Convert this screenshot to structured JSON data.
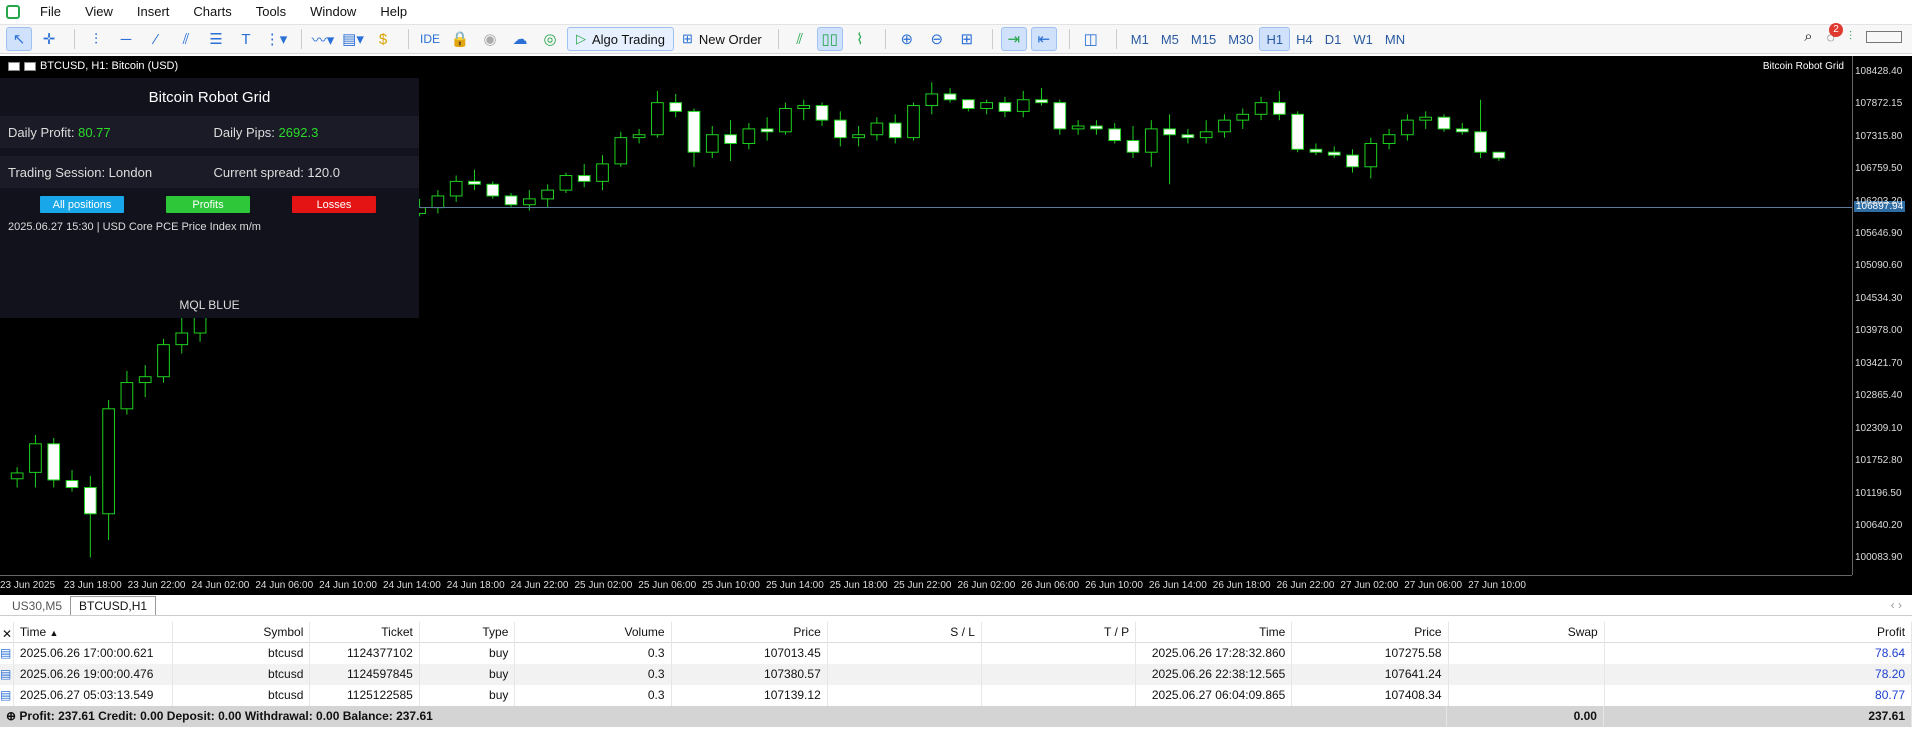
{
  "menu": {
    "items": [
      "File",
      "View",
      "Insert",
      "Charts",
      "Tools",
      "Window",
      "Help"
    ]
  },
  "toolbar": {
    "ide": "IDE",
    "algo": "Algo Trading",
    "new_order": "New Order",
    "timeframes": [
      "M1",
      "M5",
      "M15",
      "M30",
      "H1",
      "H4",
      "D1",
      "W1",
      "MN"
    ],
    "active_tf": "H1",
    "badge": "2"
  },
  "chart": {
    "title": "BTCUSD, H1:  Bitcoin (USD)",
    "indicator_name": "Bitcoin Robot Grid",
    "current_price": "106897.94",
    "yticks": [
      "108428.40",
      "107872.15",
      "107315.80",
      "106759.50",
      "106203.20",
      "105646.90",
      "105090.60",
      "104534.30",
      "103978.00",
      "103421.70",
      "102865.40",
      "102309.10",
      "101752.80",
      "101196.50",
      "100640.20",
      "100083.90"
    ],
    "xticks": [
      "23 Jun 2025",
      "23 Jun 18:00",
      "23 Jun 22:00",
      "24 Jun 02:00",
      "24 Jun 06:00",
      "24 Jun 10:00",
      "24 Jun 14:00",
      "24 Jun 18:00",
      "24 Jun 22:00",
      "25 Jun 02:00",
      "25 Jun 06:00",
      "25 Jun 10:00",
      "25 Jun 14:00",
      "25 Jun 18:00",
      "25 Jun 22:00",
      "26 Jun 02:00",
      "26 Jun 06:00",
      "26 Jun 10:00",
      "26 Jun 14:00",
      "26 Jun 18:00",
      "26 Jun 22:00",
      "27 Jun 02:00",
      "27 Jun 06:00",
      "27 Jun 10:00"
    ]
  },
  "panel": {
    "title": "Bitcoin Robot Grid",
    "daily_profit_label": "Daily Profit:",
    "daily_profit": "80.77",
    "daily_pips_label": "Daily Pips:",
    "daily_pips": "2692.3",
    "session": "Trading Session: London",
    "spread": "Current spread: 120.0",
    "btn_all": "All positions",
    "btn_profits": "Profits",
    "btn_losses": "Losses",
    "news": "2025.06.27 15:30  |  USD    Core PCE Price Index m/m",
    "footer": "MQL BLUE",
    "colors": {
      "all": "#18a7e8",
      "profits": "#2fc73a",
      "losses": "#e41414"
    }
  },
  "tabs": [
    "US30,M5",
    "BTCUSD,H1"
  ],
  "active_tab": "BTCUSD,H1",
  "table": {
    "headers": [
      "Time",
      "Symbol",
      "Ticket",
      "Type",
      "Volume",
      "Price",
      "S / L",
      "T / P",
      "Time",
      "Price",
      "Swap",
      "Profit"
    ],
    "rows": [
      [
        "2025.06.26 17:00:00.621",
        "btcusd",
        "1124377102",
        "buy",
        "0.3",
        "107013.45",
        "",
        "",
        "2025.06.26 17:28:32.860",
        "107275.58",
        "",
        "78.64"
      ],
      [
        "2025.06.26 19:00:00.476",
        "btcusd",
        "1124597845",
        "buy",
        "0.3",
        "107380.57",
        "",
        "",
        "2025.06.26 22:38:12.565",
        "107641.24",
        "",
        "78.20"
      ],
      [
        "2025.06.27 05:03:13.549",
        "btcusd",
        "1125122585",
        "buy",
        "0.3",
        "107139.12",
        "",
        "",
        "2025.06.27 06:04:09.865",
        "107408.34",
        "",
        "80.77"
      ]
    ],
    "summary": "Profit: 237.61  Credit: 0.00  Deposit: 0.00  Withdrawal: 0.00  Balance: 237.61",
    "swap_total": "0.00",
    "profit_total": "237.61"
  },
  "chart_data": {
    "type": "candlestick",
    "symbol": "BTCUSD",
    "timeframe": "H1",
    "ylim": [
      99800,
      108700
    ],
    "candles": [
      [
        101450,
        101650,
        101300,
        101550
      ],
      [
        101560,
        102200,
        101300,
        102050
      ],
      [
        102050,
        102150,
        101300,
        101430
      ],
      [
        101420,
        101600,
        101230,
        101300
      ],
      [
        101300,
        101500,
        100100,
        100850
      ],
      [
        100850,
        102800,
        100400,
        102650
      ],
      [
        102650,
        103300,
        102550,
        103100
      ],
      [
        103100,
        103400,
        102850,
        103200
      ],
      [
        103200,
        103850,
        103100,
        103750
      ],
      [
        103750,
        104250,
        103600,
        103950
      ],
      [
        103950,
        104600,
        103800,
        104450
      ],
      [
        104450,
        104900,
        104300,
        104750
      ],
      [
        104750,
        105300,
        104600,
        105100
      ],
      [
        105100,
        105700,
        104950,
        105550
      ],
      [
        105500,
        105550,
        105050,
        105150
      ],
      [
        105150,
        106350,
        105050,
        106200
      ],
      [
        106200,
        106350,
        106000,
        106100
      ],
      [
        106100,
        106100,
        105450,
        105550
      ],
      [
        105550,
        106100,
        105450,
        105850
      ],
      [
        105850,
        106250,
        105700,
        106100
      ],
      [
        106100,
        106200,
        105900,
        106050
      ],
      [
        106050,
        106150,
        105950,
        106000
      ],
      [
        106000,
        106250,
        105950,
        106100
      ],
      [
        106100,
        106400,
        106000,
        106300
      ],
      [
        106300,
        106650,
        106200,
        106550
      ],
      [
        106550,
        106750,
        106400,
        106500
      ],
      [
        106500,
        106550,
        106250,
        106300
      ],
      [
        106300,
        106350,
        106100,
        106150
      ],
      [
        106150,
        106400,
        106050,
        106250
      ],
      [
        106250,
        106500,
        106100,
        106400
      ],
      [
        106400,
        106700,
        106350,
        106650
      ],
      [
        106650,
        106850,
        106450,
        106550
      ],
      [
        106550,
        107000,
        106400,
        106850
      ],
      [
        106850,
        107400,
        106800,
        107300
      ],
      [
        107300,
        107450,
        107200,
        107350
      ],
      [
        107350,
        108100,
        107300,
        107900
      ],
      [
        107900,
        108050,
        107650,
        107750
      ],
      [
        107750,
        107800,
        106800,
        107050
      ],
      [
        107050,
        107500,
        106950,
        107350
      ],
      [
        107350,
        107600,
        106900,
        107200
      ],
      [
        107200,
        107550,
        107100,
        107450
      ],
      [
        107450,
        107650,
        107250,
        107400
      ],
      [
        107400,
        107900,
        107350,
        107800
      ],
      [
        107800,
        107950,
        107600,
        107850
      ],
      [
        107850,
        107900,
        107500,
        107600
      ],
      [
        107600,
        107750,
        107150,
        107300
      ],
      [
        107300,
        107500,
        107150,
        107350
      ],
      [
        107350,
        107650,
        107250,
        107550
      ],
      [
        107550,
        107700,
        107200,
        107300
      ],
      [
        107300,
        107900,
        107250,
        107850
      ],
      [
        107850,
        108250,
        107700,
        108050
      ],
      [
        108050,
        108150,
        107900,
        107950
      ],
      [
        107950,
        107950,
        107750,
        107800
      ],
      [
        107800,
        107950,
        107700,
        107900
      ],
      [
        107900,
        108000,
        107650,
        107750
      ],
      [
        107750,
        108100,
        107650,
        107950
      ],
      [
        107950,
        108150,
        107850,
        107900
      ],
      [
        107900,
        107950,
        107350,
        107450
      ],
      [
        107450,
        107600,
        107350,
        107500
      ],
      [
        107500,
        107600,
        107350,
        107450
      ],
      [
        107450,
        107550,
        107200,
        107250
      ],
      [
        107250,
        107500,
        106950,
        107050
      ],
      [
        107050,
        107600,
        106800,
        107450
      ],
      [
        107450,
        107700,
        106500,
        107350
      ],
      [
        107350,
        107450,
        107200,
        107300
      ],
      [
        107300,
        107600,
        107200,
        107400
      ],
      [
        107400,
        107700,
        107300,
        107600
      ],
      [
        107600,
        107800,
        107450,
        107700
      ],
      [
        107700,
        108000,
        107600,
        107900
      ],
      [
        107900,
        108100,
        107600,
        107700
      ],
      [
        107700,
        107750,
        107050,
        107100
      ],
      [
        107100,
        107200,
        107000,
        107050
      ],
      [
        107050,
        107150,
        106950,
        107000
      ],
      [
        107000,
        107100,
        106700,
        106800
      ],
      [
        106800,
        107300,
        106600,
        107200
      ],
      [
        107200,
        107450,
        107100,
        107350
      ],
      [
        107350,
        107700,
        107250,
        107600
      ],
      [
        107600,
        107750,
        107450,
        107650
      ],
      [
        107650,
        107700,
        107400,
        107450
      ],
      [
        107450,
        107550,
        107350,
        107400
      ],
      [
        107400,
        107950,
        106950,
        107050
      ],
      [
        107050,
        107050,
        106900,
        106950
      ]
    ]
  }
}
